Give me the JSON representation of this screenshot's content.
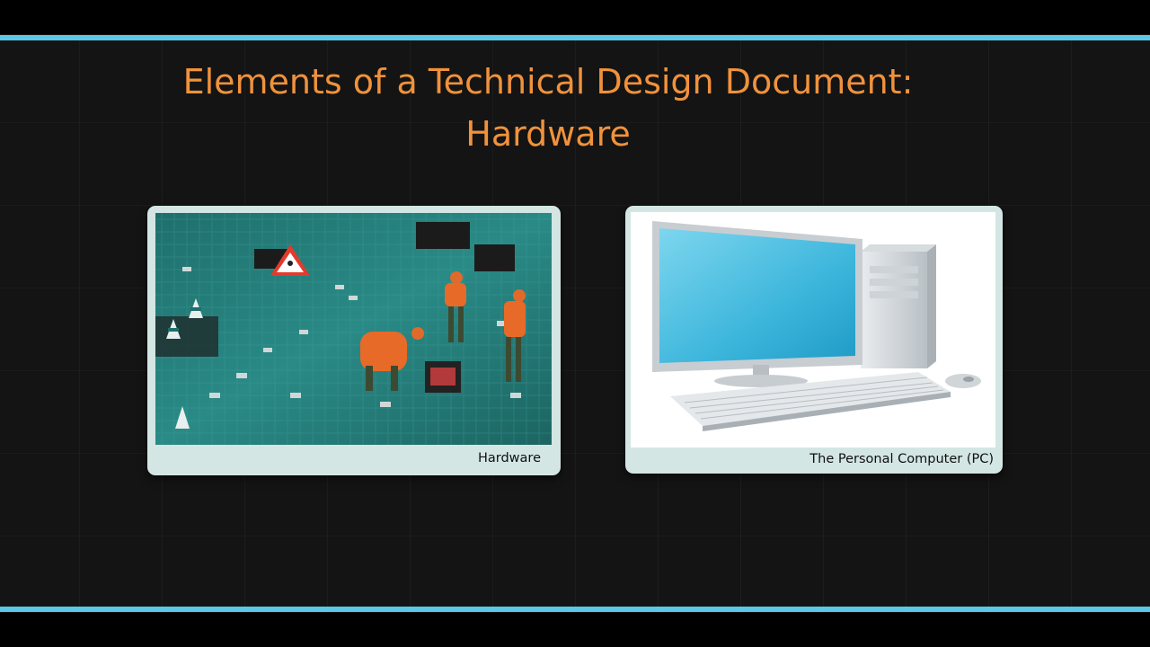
{
  "slide": {
    "title_line1": "Elements of a Technical Design Document:",
    "title_line2": "Hardware",
    "accent_color": "#5bc8e8",
    "title_color": "#f0923c"
  },
  "figures": [
    {
      "caption": "Hardware"
    },
    {
      "caption": "The Personal Computer (PC)"
    }
  ]
}
